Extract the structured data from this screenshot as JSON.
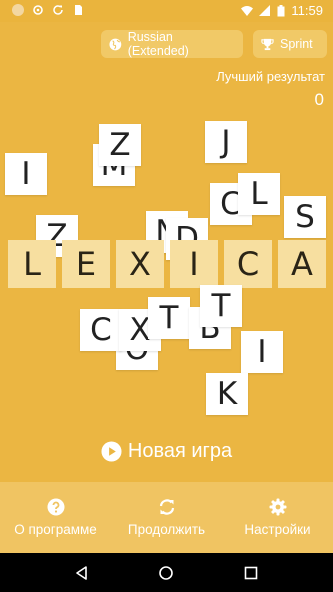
{
  "status_bar": {
    "time": "11:59"
  },
  "language_button": {
    "label": "Russian (Extended)"
  },
  "mode_button": {
    "label": "Sprint"
  },
  "best_score": {
    "label": "Лучший результат",
    "value": "0"
  },
  "title_letters": [
    "L",
    "E",
    "X",
    "I",
    "C",
    "A"
  ],
  "floating_letters": [
    "I",
    "Z",
    "M",
    "J",
    "C",
    "L",
    "S",
    "Z",
    "N",
    "D",
    "C",
    "X",
    "O",
    "T",
    "Б",
    "T",
    "I",
    "K"
  ],
  "new_game": {
    "label": "Новая игра"
  },
  "toolbar": {
    "about": "О программе",
    "continue": "Продолжить",
    "settings": "Настройки"
  },
  "colors": {
    "background": "#ebb642",
    "title_tile": "#f7dfa0",
    "toolbar": "#f0c462"
  }
}
